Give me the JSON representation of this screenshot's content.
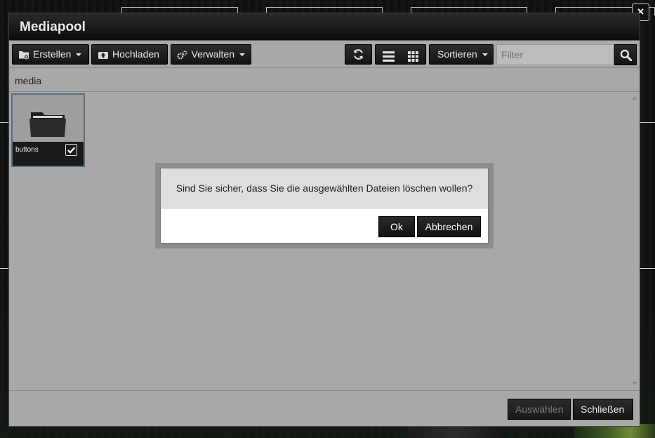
{
  "window": {
    "title": "Mediapool",
    "close_glyph": "×"
  },
  "toolbar": {
    "create_label": "Erstellen",
    "upload_label": "Hochladen",
    "manage_label": "Verwalten",
    "sort_label": "Sortieren",
    "filter_placeholder": "Filter"
  },
  "breadcrumb": {
    "path": "media"
  },
  "files": [
    {
      "name": "buttons",
      "type": "folder",
      "selected": true
    }
  ],
  "confirm_dialog": {
    "message": "Sind Sie sicher, dass Sie die ausgewählten Dateien löschen wollen?",
    "ok_label": "Ok",
    "cancel_label": "Abbrechen"
  },
  "footer": {
    "select_label": "Auswählen",
    "close_label": "Schließen"
  },
  "icons": {
    "create": "folder-plus-icon",
    "upload": "upload-icon",
    "manage": "gears-icon",
    "refresh": "refresh-icon",
    "list_view": "list-view-icon",
    "grid_view": "grid-view-icon",
    "search": "search-icon",
    "folder": "folder-icon",
    "check": "check-icon"
  },
  "colors": {
    "panel": "#a8a8a8",
    "button": "#1a1a1a",
    "selection_border": "#5a6f82"
  }
}
